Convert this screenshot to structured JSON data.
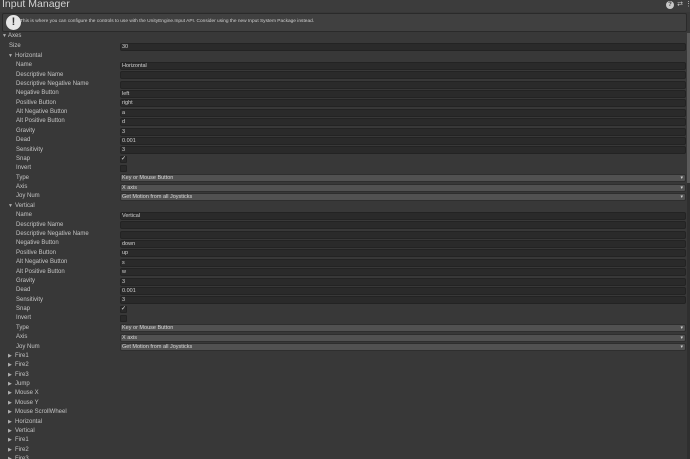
{
  "window": {
    "title": "Input Manager"
  },
  "header_icons": {
    "help": "?",
    "preset": "⇄",
    "menu": "⋮"
  },
  "help_box": {
    "icon": "!",
    "text": "This is where you can configure the controls to use with the UnityEngine.Input API. Consider using the new Input System Package instead."
  },
  "labels": {
    "axes": "Axes",
    "size": "Size",
    "name": "Name",
    "desc_name": "Descriptive Name",
    "desc_neg_name": "Descriptive Negative Name",
    "neg_button": "Negative Button",
    "pos_button": "Positive Button",
    "alt_neg_button": "Alt Negative Button",
    "alt_pos_button": "Alt Positive Button",
    "gravity": "Gravity",
    "dead": "Dead",
    "sensitivity": "Sensitivity",
    "snap": "Snap",
    "invert": "Invert",
    "type": "Type",
    "axis": "Axis",
    "joy_num": "Joy Num"
  },
  "axes": {
    "size": "30",
    "horizontal": {
      "header": "Horizontal",
      "name": "Horizontal",
      "descriptive_name": "",
      "descriptive_negative_name": "",
      "negative_button": "left",
      "positive_button": "right",
      "alt_negative_button": "a",
      "alt_positive_button": "d",
      "gravity": "3",
      "dead": "0.001",
      "sensitivity": "3",
      "snap_mark": "✓",
      "invert_mark": "",
      "type": "Key or Mouse Button",
      "axis": "X axis",
      "joy_num": "Get Motion from all Joysticks"
    },
    "vertical": {
      "header": "Vertical",
      "name": "Vertical",
      "descriptive_name": "",
      "descriptive_negative_name": "",
      "negative_button": "down",
      "positive_button": "up",
      "alt_negative_button": "s",
      "alt_positive_button": "w",
      "gravity": "3",
      "dead": "0.001",
      "sensitivity": "3",
      "snap_mark": "✓",
      "invert_mark": "",
      "type": "Key or Mouse Button",
      "axis": "X axis",
      "joy_num": "Get Motion from all Joysticks"
    },
    "collapsed": [
      "Fire1",
      "Fire2",
      "Fire3",
      "Jump",
      "Mouse X",
      "Mouse Y",
      "Mouse ScrollWheel",
      "Horizontal",
      "Vertical",
      "Fire1",
      "Fire2",
      "Fire3"
    ]
  },
  "icons": {
    "expanded": "expanded-arrow-icon",
    "collapsed": "collapsed-arrow-icon",
    "dropdown": "dropdown-caret-icon"
  },
  "colors": {
    "background": "#383838",
    "field": "#2a2a2a",
    "dropdown": "#515151",
    "text": "#c4c4c4"
  }
}
